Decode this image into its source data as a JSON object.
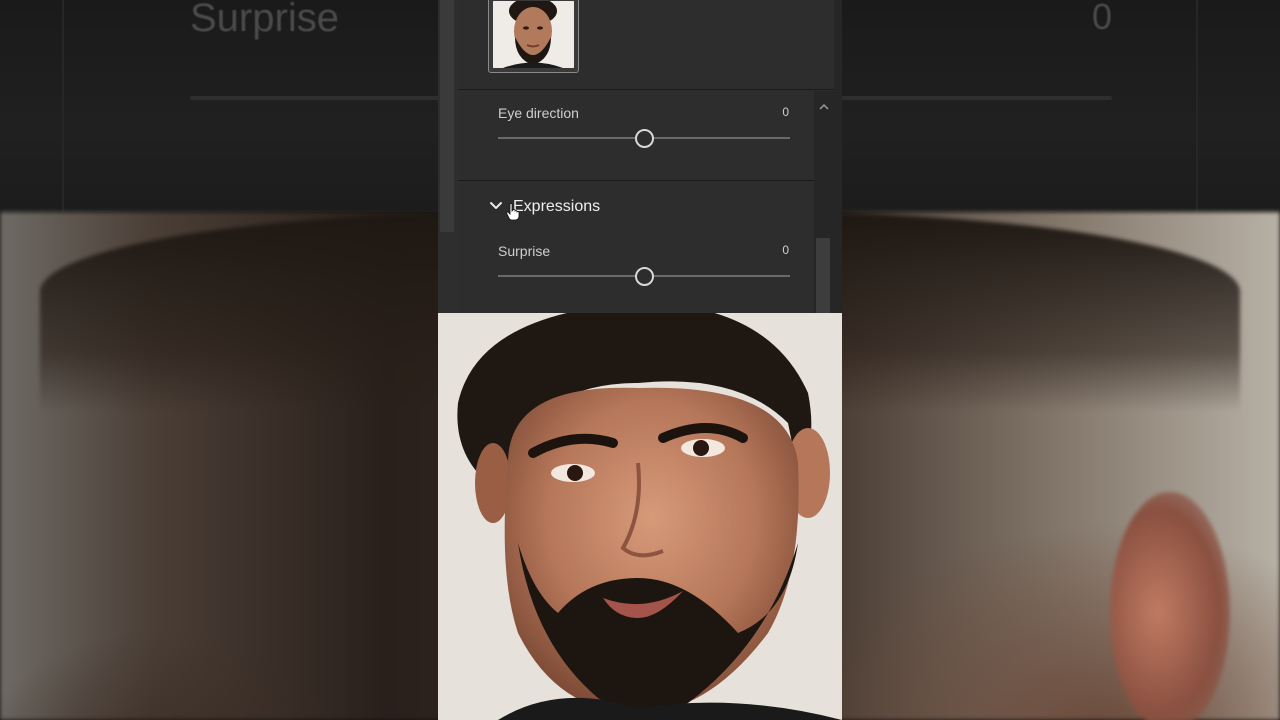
{
  "background": {
    "ghost_label": "Surprise",
    "ghost_value": "0"
  },
  "panel": {
    "thumbnail_alt": "face-thumbnail",
    "eye_direction": {
      "label": "Eye direction",
      "value": "0",
      "level": 0.5
    },
    "expressions": {
      "title": "Expressions",
      "expanded": true,
      "surprise": {
        "label": "Surprise",
        "value": "0",
        "level": 0.5
      }
    }
  },
  "colors": {
    "panel_bg": "#2d2d2d",
    "text": "#cfcfcf",
    "track": "#6a6a6a",
    "knob": "#d8d8d8"
  }
}
